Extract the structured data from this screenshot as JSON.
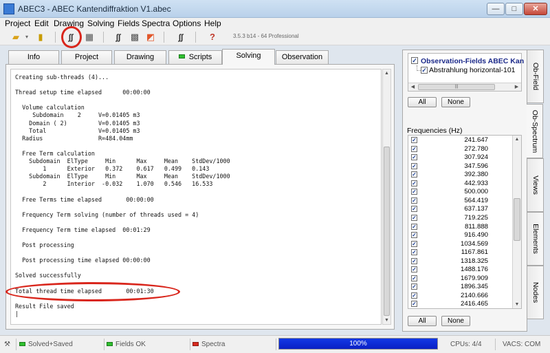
{
  "window": {
    "title": "ABEC3 - ABEC Kantendiffraktion V1.abec",
    "min_glyph": "—",
    "max_glyph": "□",
    "close_glyph": "✕"
  },
  "menu": [
    "Project",
    "Edit",
    "Drawing",
    "Solving",
    "Fields",
    "Spectra",
    "Options",
    "Help"
  ],
  "toolbar": {
    "version": "3.5.3 b14 - 64 Professional",
    "icons": [
      "open-folder-icon",
      "save-icon",
      "solve-icon",
      "mesh-icon",
      "spectrum-icon",
      "grid-view-icon",
      "color-map-icon",
      "waveform-icon",
      "help-icon"
    ],
    "help_glyph": "?"
  },
  "tabs": [
    {
      "label": "Info"
    },
    {
      "label": "Project"
    },
    {
      "label": "Drawing"
    },
    {
      "label": "Scripts"
    },
    {
      "label": "Solving",
      "active": true
    },
    {
      "label": "Observation"
    }
  ],
  "log_lines": [
    "Creating sub-threads (4)...",
    "",
    "Thread setup time elapsed      00:00:00",
    "",
    "  Volume calculation",
    "     Subdomain    2     V=0.01405 m3",
    "    Domain ( 2)         V=0.01405 m3",
    "    Total               V=0.01405 m3",
    "  Radius                R=484.04mm",
    "",
    "  Free Term calculation",
    "    Subdomain  ElType     Min      Max     Mean    StdDev/1000",
    "        1      Exterior   0.372    0.617   0.499   0.143",
    "    Subdomain  ElType     Min      Max     Mean    StdDev/1000",
    "        2      Interior  -0.032    1.070   0.546   16.533",
    "",
    "  Free Terms time elapsed       00:00:00",
    "",
    "  Frequency Term solving (number of threads used = 4)",
    "",
    "  Frequency Term time elapsed  00:01:29",
    "",
    "  Post processing",
    "",
    "  Post processing time elapsed 00:00:00",
    "",
    "Solved successfully",
    "",
    "Total thread time elapsed       00:01:30",
    "",
    "Result File saved",
    "|"
  ],
  "side": {
    "obs_title": "Observation-Fields ABEC Kan",
    "obs_child": "Abstrahlung horizontal-101",
    "scroll_grip": "|||",
    "all_label": "All",
    "none_label": "None",
    "freq_label": "Frequencies  (Hz)",
    "frequencies": [
      "241.647",
      "272.780",
      "307.924",
      "347.596",
      "392.380",
      "442.933",
      "500.000",
      "564.419",
      "637.137",
      "719.225",
      "811.888",
      "916.490",
      "1034.569",
      "1167.861",
      "1318.325",
      "1488.176",
      "1679.909",
      "1896.345",
      "2140.666",
      "2416.465"
    ],
    "check_glyph": "✓",
    "vtabs": [
      "Ob-Field",
      "Ob-Spectrum",
      "Views",
      "Elements",
      "Nodes"
    ]
  },
  "status": {
    "solved": "Solved+Saved",
    "fields": "Fields OK",
    "spectra": "Spectra",
    "progress_text": "100%",
    "progress_fraction": 1.0,
    "cpus": "CPUs: 4/4",
    "vacs": "VACS: COM"
  }
}
